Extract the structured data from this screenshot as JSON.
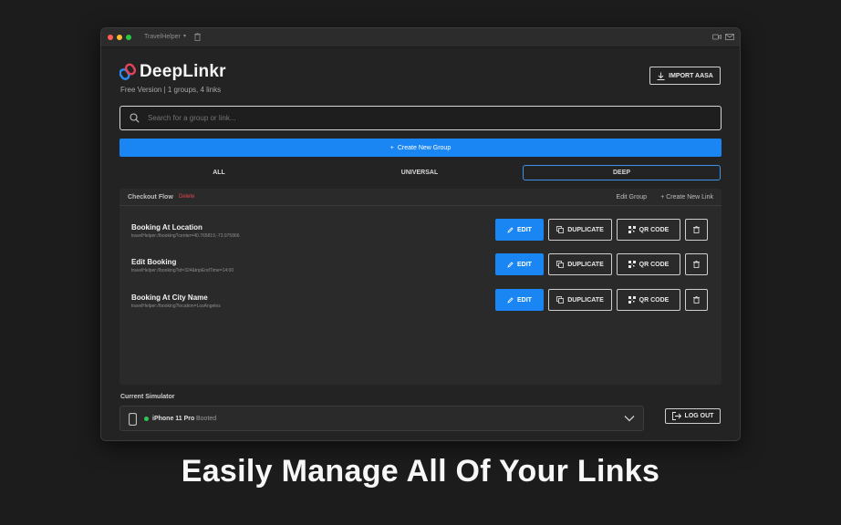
{
  "window": {
    "title": "TravelHelper"
  },
  "app": {
    "logo_text": "DeepLinkr",
    "subtitle": "Free Version | 1 groups, 4 links",
    "import_label": "IMPORT AASA"
  },
  "search": {
    "placeholder": "Search for a group or link..."
  },
  "create_group_label": "Create New Group",
  "tabs": [
    {
      "label": "ALL",
      "selected": false
    },
    {
      "label": "UNIVERSAL",
      "selected": false
    },
    {
      "label": "DEEP",
      "selected": true
    }
  ],
  "group": {
    "name": "Checkout Flow",
    "delete_label": "Delete",
    "edit_label": "Edit Group",
    "new_link_label": "+ Create New Link",
    "links": [
      {
        "name": "Booking At Location",
        "url": "travelHelper://booking?center=40.765819,-73.975866"
      },
      {
        "name": "Edit Booking",
        "url": "travelHelper://booking?id=324&tripEndTime=14:00"
      },
      {
        "name": "Booking At City Name",
        "url": "travelHelper://booking?location=LosAngeles"
      }
    ]
  },
  "buttons": {
    "edit": "EDIT",
    "duplicate": "DUPLICATE",
    "qr": "QR CODE"
  },
  "simulator": {
    "label": "Current Simulator",
    "device": "iPhone 11 Pro",
    "status": "Booted",
    "status_color": "#30c75a"
  },
  "logout_label": "LOG OUT",
  "caption": "Easily Manage All Of Your Links",
  "colors": {
    "accent": "#1a86f3",
    "danger": "#e0444a",
    "background": "#232323"
  }
}
